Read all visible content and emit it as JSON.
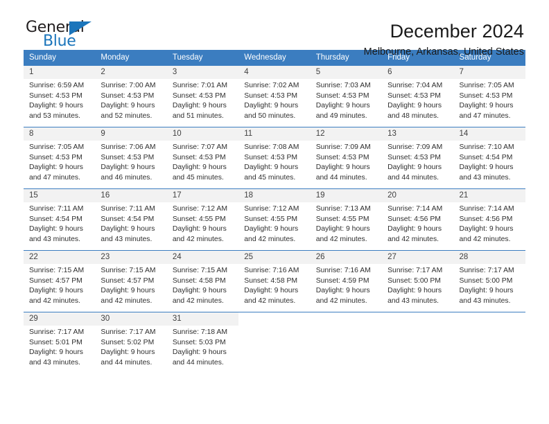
{
  "brand": {
    "name_part1": "General",
    "name_part2": "Blue",
    "color_dark": "#231f20",
    "color_blue": "#1b75bb"
  },
  "header": {
    "title": "December 2024",
    "subtitle": "Melbourne, Arkansas, United States"
  },
  "theme": {
    "header_row_bg": "#3b7dc0",
    "day_number_bg": "#f2f2f2",
    "cell_bg": "#ffffff",
    "row_border": "#3b7dc0"
  },
  "weekday_headers": [
    "Sunday",
    "Monday",
    "Tuesday",
    "Wednesday",
    "Thursday",
    "Friday",
    "Saturday"
  ],
  "weeks": [
    [
      {
        "day": "1",
        "sunrise": "Sunrise: 6:59 AM",
        "sunset": "Sunset: 4:53 PM",
        "daylight1": "Daylight: 9 hours",
        "daylight2": "and 53 minutes."
      },
      {
        "day": "2",
        "sunrise": "Sunrise: 7:00 AM",
        "sunset": "Sunset: 4:53 PM",
        "daylight1": "Daylight: 9 hours",
        "daylight2": "and 52 minutes."
      },
      {
        "day": "3",
        "sunrise": "Sunrise: 7:01 AM",
        "sunset": "Sunset: 4:53 PM",
        "daylight1": "Daylight: 9 hours",
        "daylight2": "and 51 minutes."
      },
      {
        "day": "4",
        "sunrise": "Sunrise: 7:02 AM",
        "sunset": "Sunset: 4:53 PM",
        "daylight1": "Daylight: 9 hours",
        "daylight2": "and 50 minutes."
      },
      {
        "day": "5",
        "sunrise": "Sunrise: 7:03 AM",
        "sunset": "Sunset: 4:53 PM",
        "daylight1": "Daylight: 9 hours",
        "daylight2": "and 49 minutes."
      },
      {
        "day": "6",
        "sunrise": "Sunrise: 7:04 AM",
        "sunset": "Sunset: 4:53 PM",
        "daylight1": "Daylight: 9 hours",
        "daylight2": "and 48 minutes."
      },
      {
        "day": "7",
        "sunrise": "Sunrise: 7:05 AM",
        "sunset": "Sunset: 4:53 PM",
        "daylight1": "Daylight: 9 hours",
        "daylight2": "and 47 minutes."
      }
    ],
    [
      {
        "day": "8",
        "sunrise": "Sunrise: 7:05 AM",
        "sunset": "Sunset: 4:53 PM",
        "daylight1": "Daylight: 9 hours",
        "daylight2": "and 47 minutes."
      },
      {
        "day": "9",
        "sunrise": "Sunrise: 7:06 AM",
        "sunset": "Sunset: 4:53 PM",
        "daylight1": "Daylight: 9 hours",
        "daylight2": "and 46 minutes."
      },
      {
        "day": "10",
        "sunrise": "Sunrise: 7:07 AM",
        "sunset": "Sunset: 4:53 PM",
        "daylight1": "Daylight: 9 hours",
        "daylight2": "and 45 minutes."
      },
      {
        "day": "11",
        "sunrise": "Sunrise: 7:08 AM",
        "sunset": "Sunset: 4:53 PM",
        "daylight1": "Daylight: 9 hours",
        "daylight2": "and 45 minutes."
      },
      {
        "day": "12",
        "sunrise": "Sunrise: 7:09 AM",
        "sunset": "Sunset: 4:53 PM",
        "daylight1": "Daylight: 9 hours",
        "daylight2": "and 44 minutes."
      },
      {
        "day": "13",
        "sunrise": "Sunrise: 7:09 AM",
        "sunset": "Sunset: 4:53 PM",
        "daylight1": "Daylight: 9 hours",
        "daylight2": "and 44 minutes."
      },
      {
        "day": "14",
        "sunrise": "Sunrise: 7:10 AM",
        "sunset": "Sunset: 4:54 PM",
        "daylight1": "Daylight: 9 hours",
        "daylight2": "and 43 minutes."
      }
    ],
    [
      {
        "day": "15",
        "sunrise": "Sunrise: 7:11 AM",
        "sunset": "Sunset: 4:54 PM",
        "daylight1": "Daylight: 9 hours",
        "daylight2": "and 43 minutes."
      },
      {
        "day": "16",
        "sunrise": "Sunrise: 7:11 AM",
        "sunset": "Sunset: 4:54 PM",
        "daylight1": "Daylight: 9 hours",
        "daylight2": "and 43 minutes."
      },
      {
        "day": "17",
        "sunrise": "Sunrise: 7:12 AM",
        "sunset": "Sunset: 4:55 PM",
        "daylight1": "Daylight: 9 hours",
        "daylight2": "and 42 minutes."
      },
      {
        "day": "18",
        "sunrise": "Sunrise: 7:12 AM",
        "sunset": "Sunset: 4:55 PM",
        "daylight1": "Daylight: 9 hours",
        "daylight2": "and 42 minutes."
      },
      {
        "day": "19",
        "sunrise": "Sunrise: 7:13 AM",
        "sunset": "Sunset: 4:55 PM",
        "daylight1": "Daylight: 9 hours",
        "daylight2": "and 42 minutes."
      },
      {
        "day": "20",
        "sunrise": "Sunrise: 7:14 AM",
        "sunset": "Sunset: 4:56 PM",
        "daylight1": "Daylight: 9 hours",
        "daylight2": "and 42 minutes."
      },
      {
        "day": "21",
        "sunrise": "Sunrise: 7:14 AM",
        "sunset": "Sunset: 4:56 PM",
        "daylight1": "Daylight: 9 hours",
        "daylight2": "and 42 minutes."
      }
    ],
    [
      {
        "day": "22",
        "sunrise": "Sunrise: 7:15 AM",
        "sunset": "Sunset: 4:57 PM",
        "daylight1": "Daylight: 9 hours",
        "daylight2": "and 42 minutes."
      },
      {
        "day": "23",
        "sunrise": "Sunrise: 7:15 AM",
        "sunset": "Sunset: 4:57 PM",
        "daylight1": "Daylight: 9 hours",
        "daylight2": "and 42 minutes."
      },
      {
        "day": "24",
        "sunrise": "Sunrise: 7:15 AM",
        "sunset": "Sunset: 4:58 PM",
        "daylight1": "Daylight: 9 hours",
        "daylight2": "and 42 minutes."
      },
      {
        "day": "25",
        "sunrise": "Sunrise: 7:16 AM",
        "sunset": "Sunset: 4:58 PM",
        "daylight1": "Daylight: 9 hours",
        "daylight2": "and 42 minutes."
      },
      {
        "day": "26",
        "sunrise": "Sunrise: 7:16 AM",
        "sunset": "Sunset: 4:59 PM",
        "daylight1": "Daylight: 9 hours",
        "daylight2": "and 42 minutes."
      },
      {
        "day": "27",
        "sunrise": "Sunrise: 7:17 AM",
        "sunset": "Sunset: 5:00 PM",
        "daylight1": "Daylight: 9 hours",
        "daylight2": "and 43 minutes."
      },
      {
        "day": "28",
        "sunrise": "Sunrise: 7:17 AM",
        "sunset": "Sunset: 5:00 PM",
        "daylight1": "Daylight: 9 hours",
        "daylight2": "and 43 minutes."
      }
    ],
    [
      {
        "day": "29",
        "sunrise": "Sunrise: 7:17 AM",
        "sunset": "Sunset: 5:01 PM",
        "daylight1": "Daylight: 9 hours",
        "daylight2": "and 43 minutes."
      },
      {
        "day": "30",
        "sunrise": "Sunrise: 7:17 AM",
        "sunset": "Sunset: 5:02 PM",
        "daylight1": "Daylight: 9 hours",
        "daylight2": "and 44 minutes."
      },
      {
        "day": "31",
        "sunrise": "Sunrise: 7:18 AM",
        "sunset": "Sunset: 5:03 PM",
        "daylight1": "Daylight: 9 hours",
        "daylight2": "and 44 minutes."
      },
      {
        "day": "",
        "sunrise": "",
        "sunset": "",
        "daylight1": "",
        "daylight2": ""
      },
      {
        "day": "",
        "sunrise": "",
        "sunset": "",
        "daylight1": "",
        "daylight2": ""
      },
      {
        "day": "",
        "sunrise": "",
        "sunset": "",
        "daylight1": "",
        "daylight2": ""
      },
      {
        "day": "",
        "sunrise": "",
        "sunset": "",
        "daylight1": "",
        "daylight2": ""
      }
    ]
  ]
}
